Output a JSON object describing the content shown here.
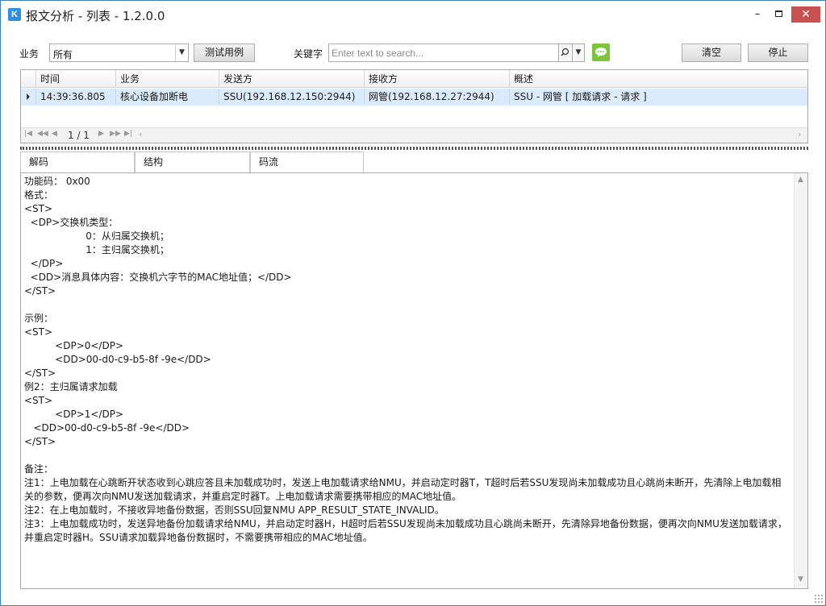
{
  "window": {
    "title": "报文分析 - 列表 - 1.2.0.0",
    "min_glyph": "–",
    "close_glyph": "✕"
  },
  "toolbar": {
    "business_label": "业务",
    "business_value": "所有",
    "test_button": "测试用例",
    "keyword_label": "关键字",
    "search_placeholder": "Enter text to search...",
    "clear_button": "清空",
    "stop_button": "停止"
  },
  "grid": {
    "columns": [
      "时间",
      "业务",
      "发送方",
      "接收方",
      "概述"
    ],
    "rows": [
      [
        "14:39:36.805",
        "核心设备加断电",
        "SSU(192.168.12.150:2944)",
        "网管(192.168.12.27:2944)",
        "SSU - 网管 [ 加载请求 - 请求 ]"
      ]
    ],
    "pager_text": "1 / 1"
  },
  "tabs": [
    "解码",
    "结构",
    "码流"
  ],
  "content": {
    "text": "功能码： 0x00\n格式：\n<ST>\n  <DP>交换机类型：\n                    0：从归属交换机；\n                    1：主归属交换机；\n  </DP>\n  <DD>消息具体内容：交换机六字节的MAC地址值；</DD>\n</ST>\n\n示例：\n<ST>\n          <DP>0</DP>\n          <DD>00-d0-c9-b5-8f -9e</DD>\n</ST>\n例2：主归属请求加载\n<ST>\n          <DP>1</DP>\n   <DD>00-d0-c9-b5-8f -9e</DD>\n</ST>\n\n备注：\n注1：上电加载在心跳断开状态收到心跳应答且未加载成功时，发送上电加载请求给NMU，并启动定时器T，T超时后若SSU发现尚未加载成功且心跳尚未断开，先清除上电加载相关的参数，便再次向NMU发送加载请求，并重启定时器T。上电加载请求需要携带相应的MAC地址值。\n注2：在上电加载时，不接收异地备份数据，否则SSU回复NMU APP_RESULT_STATE_INVALID。\n注3：上电加载成功时，发送异地备份加载请求给NMU，并启动定时器H，H超时后若SSU发现尚未加载成功且心跳尚未断开，先清除异地备份数据，便再次向NMU发送加载请求，并重启定时器H。SSU请求加载异地备份数据时，不需要携带相应的MAC地址值。"
  },
  "icons": {
    "app": "app-logo-icon",
    "search": "search-icon",
    "chat": "chat-bubble-icon"
  },
  "colors": {
    "accent": "#3b7fc4",
    "close": "#c75050",
    "row_selected": "#dcebfb",
    "chat": "#7dc53a"
  }
}
